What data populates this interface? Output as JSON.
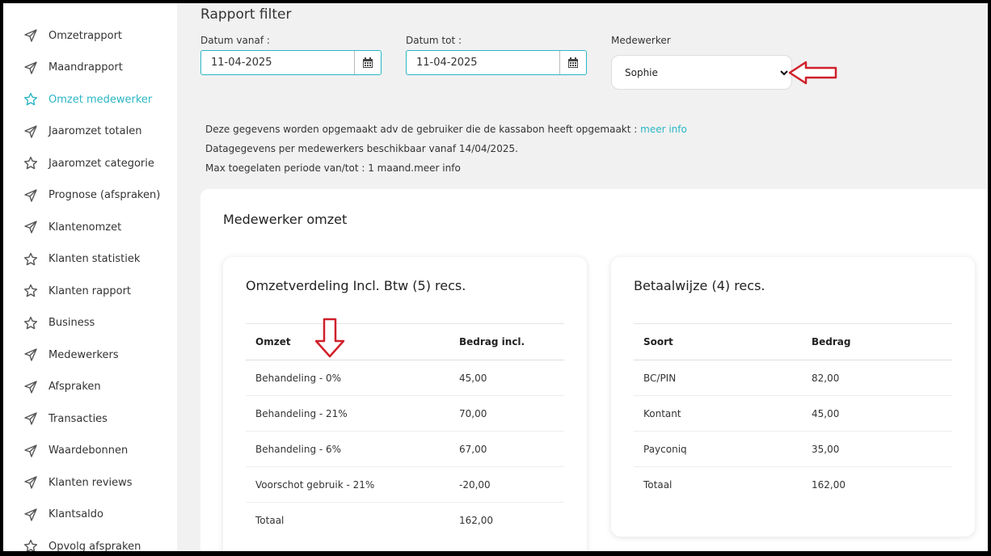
{
  "sidebar": {
    "items": [
      {
        "label": "Omzetrapport",
        "icon": "send-icon"
      },
      {
        "label": "Maandrapport",
        "icon": "send-icon"
      },
      {
        "label": "Omzet medewerker",
        "icon": "star-icon",
        "active": true
      },
      {
        "label": "Jaaromzet totalen",
        "icon": "send-icon"
      },
      {
        "label": "Jaaromzet categorie",
        "icon": "star-icon"
      },
      {
        "label": "Prognose (afspraken)",
        "icon": "send-icon"
      },
      {
        "label": "Klantenomzet",
        "icon": "send-icon"
      },
      {
        "label": "Klanten statistiek",
        "icon": "star-icon"
      },
      {
        "label": "Klanten rapport",
        "icon": "star-icon"
      },
      {
        "label": "Business",
        "icon": "star-icon"
      },
      {
        "label": "Medewerkers",
        "icon": "send-icon"
      },
      {
        "label": "Afspraken",
        "icon": "send-icon"
      },
      {
        "label": "Transacties",
        "icon": "send-icon"
      },
      {
        "label": "Waardebonnen",
        "icon": "send-icon"
      },
      {
        "label": "Klanten reviews",
        "icon": "send-icon"
      },
      {
        "label": "Klantsaldo",
        "icon": "send-icon"
      },
      {
        "label": "Opvolg afspraken",
        "icon": "star-icon"
      }
    ]
  },
  "filter": {
    "title": "Rapport filter",
    "date_from_label": "Datum vanaf :",
    "date_from_value": "11-04-2025",
    "date_to_label": "Datum tot :",
    "date_to_value": "11-04-2025",
    "employee_label": "Medewerker",
    "employee_value": "Sophie"
  },
  "info": {
    "line1": "Deze gegevens worden opgemaakt adv de gebruiker die de kassabon heeft opgemaakt : ",
    "line1_link": "meer info",
    "line2": "Datagegevens per medewerkers beschikbaar vanaf 14/04/2025.",
    "line3": "Max toegelaten periode van/tot : 1 maand.meer info"
  },
  "report": {
    "title": "Medewerker omzet",
    "omzet": {
      "title": "Omzetverdeling Incl. Btw (5) recs.",
      "headers": [
        "Omzet",
        "Bedrag incl."
      ],
      "rows": [
        [
          "Behandeling - 0%",
          "45,00"
        ],
        [
          "Behandeling - 21%",
          "70,00"
        ],
        [
          "Behandeling - 6%",
          "67,00"
        ],
        [
          "Voorschot gebruik - 21%",
          "-20,00"
        ],
        [
          "Totaal",
          "162,00"
        ]
      ]
    },
    "betaal": {
      "title": "Betaalwijze (4) recs.",
      "headers": [
        "Soort",
        "Bedrag"
      ],
      "rows": [
        [
          "BC/PIN",
          "82,00"
        ],
        [
          "Kontant",
          "45,00"
        ],
        [
          "Payconiq",
          "35,00"
        ],
        [
          "Totaal",
          "162,00"
        ]
      ]
    }
  },
  "colors": {
    "accent": "#2bb6c4",
    "annotation": "#d0202a"
  }
}
